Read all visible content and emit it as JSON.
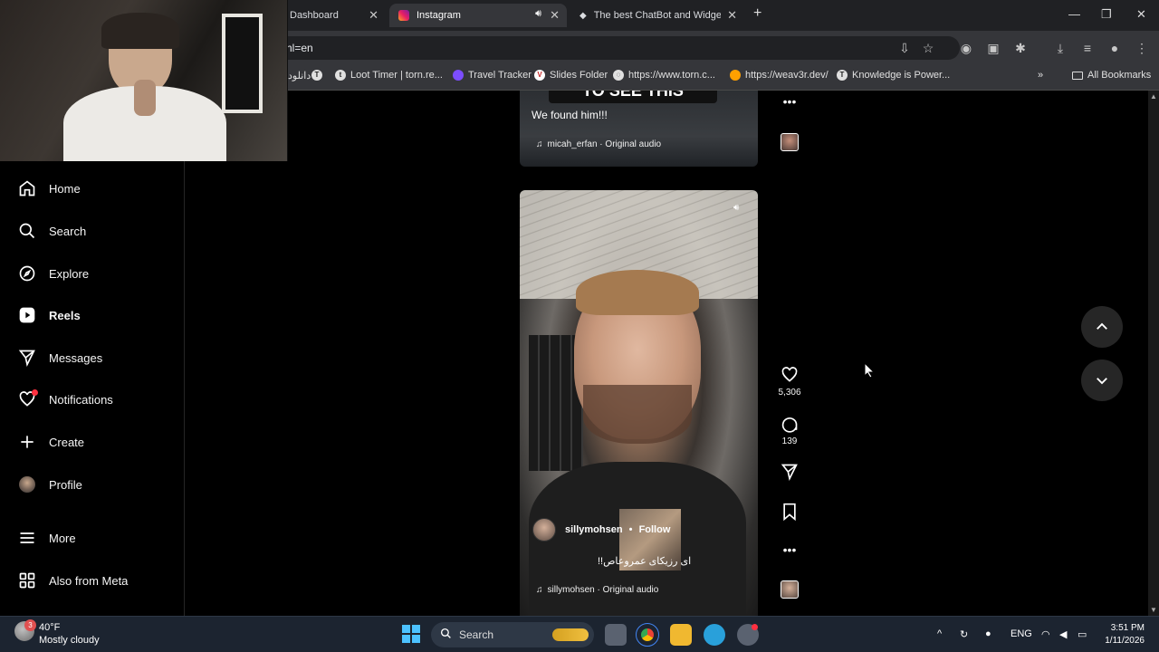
{
  "browser": {
    "tabs": [
      {
        "label": "Dashboard",
        "active": false
      },
      {
        "label": "Instagram",
        "active": true
      },
      {
        "label": "The best ChatBot and Widgets",
        "active": false
      }
    ],
    "url": "hl=en",
    "bookmarks": [
      "دانلود",
      "",
      "Loot Timer | torn.re...",
      "Travel Tracker",
      "Slides Folder",
      "https://www.torn.c...",
      "https://weav3r.dev/",
      "Knowledge is Power..."
    ],
    "all_bookmarks": "All Bookmarks"
  },
  "sidebar": {
    "items": [
      {
        "label": "Home",
        "icon": "home-icon"
      },
      {
        "label": "Search",
        "icon": "search-icon"
      },
      {
        "label": "Explore",
        "icon": "compass-icon"
      },
      {
        "label": "Reels",
        "icon": "reels-icon"
      },
      {
        "label": "Messages",
        "icon": "messages-icon"
      },
      {
        "label": "Notifications",
        "icon": "heart-icon"
      },
      {
        "label": "Create",
        "icon": "plus-icon"
      },
      {
        "label": "Profile",
        "icon": "avatar"
      },
      {
        "label": "More",
        "icon": "menu-icon"
      },
      {
        "label": "Also from Meta",
        "icon": "meta-icon"
      }
    ]
  },
  "reel1": {
    "caption": "We found him!!!",
    "audio": "micah_erfan · Original audio",
    "overlay_text": "TO SEE THIS"
  },
  "reel2": {
    "username": "sillymohsen",
    "separator": "•",
    "follow": "Follow",
    "caption": "ای رزیکای عمروعاص!!",
    "audio": "sillymohsen · Original audio",
    "likes": "5,306",
    "comments": "139"
  },
  "taskbar": {
    "weather_temp": "40°F",
    "weather_desc": "Mostly cloudy",
    "weather_badge": "3",
    "search": "Search",
    "lang": "ENG",
    "time": "3:51 PM",
    "date": "1/11/2026"
  },
  "colors": {
    "accent_red": "#ff3040",
    "background": "#000000",
    "taskbar": "#1c2430"
  }
}
